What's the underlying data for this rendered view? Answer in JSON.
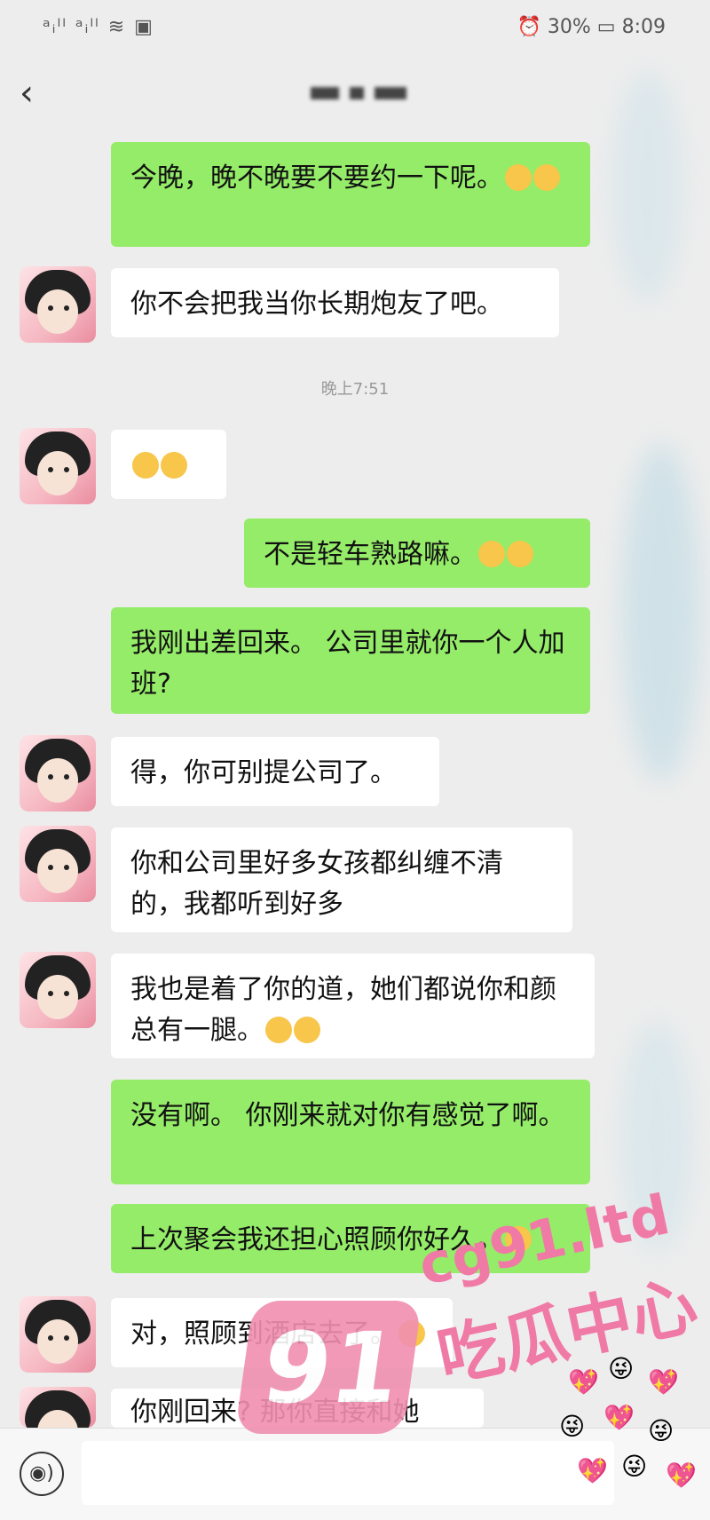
{
  "status_bar": {
    "signal": "ᵃᵢˡˡ ᵃᵢˡˡ ≋ ▣",
    "right": "⏰ 30% ▭ 8:09"
  },
  "header": {
    "back_glyph": "‹"
  },
  "timestamp": "晚上7:51",
  "messages": [
    {
      "side": "right",
      "text": "今晚，晚不晚要不要约一下呢。"
    },
    {
      "side": "left",
      "text": "你不会把我当你长期炮友了吧。"
    },
    {
      "side": "left",
      "text": ""
    },
    {
      "side": "right",
      "text": "不是轻车熟路嘛。"
    },
    {
      "side": "right",
      "text": "我刚出差回来。 公司里就你一个人加班?"
    },
    {
      "side": "left",
      "text": "得，你可别提公司了。"
    },
    {
      "side": "left",
      "text": "你和公司里好多女孩都纠缠不清的，我都听到好多"
    },
    {
      "side": "left",
      "text": "我也是着了你的道，她们都说你和颜总有一腿。"
    },
    {
      "side": "right",
      "text": "没有啊。 你刚来就对你有感觉了啊。"
    },
    {
      "side": "right",
      "text": "上次聚会我还担心照顾你好久。"
    },
    {
      "side": "left",
      "text": "对，照顾到酒店去了。"
    },
    {
      "side": "left",
      "text": "你刚回来? 那你直接和她"
    }
  ],
  "watermark": {
    "logo": "91",
    "url": "cg91.ltd",
    "label": "吃瓜中心"
  },
  "input": {
    "voice_glyph": "◉)"
  },
  "colors": {
    "self_bubble": "#95ec69",
    "other_bubble": "#ffffff",
    "background": "#ededed",
    "watermark": "#f07aa6"
  }
}
